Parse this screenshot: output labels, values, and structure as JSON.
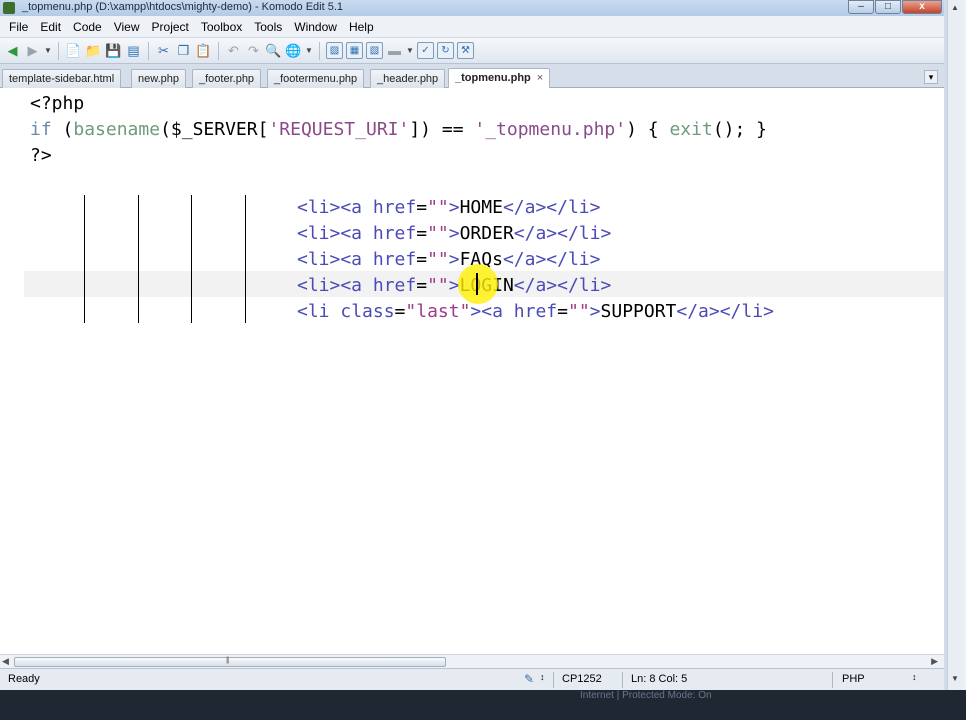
{
  "window": {
    "title": "_topmenu.php (D:\\xampp\\htdocs\\mighty-demo) - Komodo Edit 5.1",
    "controls": {
      "minimize": "–",
      "maximize": "□",
      "close": "x"
    }
  },
  "menubar": {
    "items": [
      "File",
      "Edit",
      "Code",
      "View",
      "Project",
      "Toolbox",
      "Tools",
      "Window",
      "Help"
    ]
  },
  "toolbar": {
    "icons": [
      "back-icon",
      "forward-icon",
      "dropdown-icon",
      "new-file-icon",
      "open-folder-icon",
      "save-icon",
      "save-all-icon",
      "cut-icon",
      "copy-icon",
      "paste-icon",
      "undo-icon",
      "redo-icon",
      "find-icon",
      "browser-preview-icon",
      "dropdown-icon",
      "toggle-left-pane-icon",
      "toggle-bottom-pane-icon",
      "toggle-right-pane-icon",
      "dropdown-icon",
      "komodo-icon",
      "refresh-icon",
      "tools-icon"
    ]
  },
  "tabs": [
    {
      "label": "template-sidebar.html",
      "active": false
    },
    {
      "label": "new.php",
      "active": false
    },
    {
      "label": "_footer.php",
      "active": false
    },
    {
      "label": "_footermenu.php",
      "active": false
    },
    {
      "label": "_header.php",
      "active": false
    },
    {
      "label": "_topmenu.php",
      "active": true,
      "close": "×"
    }
  ],
  "editor": {
    "line1": {
      "text": "<?php"
    },
    "line2": {
      "kw_if": "if",
      "sp1": " (",
      "fn_basename": "basename",
      "p2": "($_SERVER[",
      "str_req": "'REQUEST_URI'",
      "p3": "]) == ",
      "str_file": "'_topmenu.php'",
      "p4": ") { ",
      "fn_exit": "exit",
      "p5": "(); }"
    },
    "line3": {
      "text": "?>"
    },
    "menu_items": [
      {
        "open": "<li><a ",
        "attr": "href",
        "eq": "=",
        "val": "\"\"",
        "gt": ">",
        "text": "HOME",
        "close": "</a></li>"
      },
      {
        "open": "<li><a ",
        "attr": "href",
        "eq": "=",
        "val": "\"\"",
        "gt": ">",
        "text": "ORDER",
        "close": "</a></li>"
      },
      {
        "open": "<li><a ",
        "attr": "href",
        "eq": "=",
        "val": "\"\"",
        "gt": ">",
        "text": "FAQs",
        "close": "</a></li>"
      },
      {
        "open": "<li><a ",
        "attr": "href",
        "eq": "=",
        "val": "\"\"",
        "gt": ">",
        "text": "LOGIN",
        "close": "</a></li>"
      }
    ],
    "last_item": {
      "open": "<li ",
      "attr_class": "class",
      "eq": "=",
      "val_class": "\"last\"",
      "mid": "><a ",
      "attr_href": "href",
      "eq2": "=",
      "val_href": "\"\"",
      "gt": ">",
      "text": "SUPPORT",
      "close": "</a></li>"
    }
  },
  "status": {
    "ready": "Ready",
    "encoding": "CP1252",
    "position": "Ln: 8 Col: 5",
    "language": "PHP"
  },
  "colors": {
    "keyword": "#6c8ba8",
    "tag": "#4b4bb8",
    "string": "#a03a8a",
    "cursor_highlight": "#fff000"
  },
  "background_fragment": "Internet | Protected Mode: On"
}
